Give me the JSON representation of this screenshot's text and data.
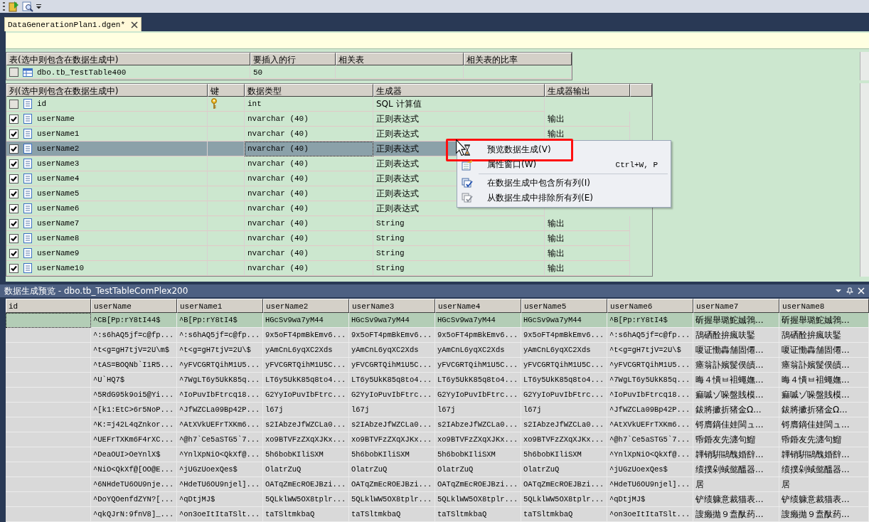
{
  "document_tab": {
    "title": "DataGenerationPlan1.dgen*"
  },
  "tables_grid": {
    "columns": [
      "表(选中则包含在数据生成中)",
      "要插入的行",
      "相关表",
      "相关表的比率"
    ],
    "rows": [
      {
        "checked": false,
        "cells": [
          "dbo.tb_TestTable400",
          "50"
        ]
      }
    ]
  },
  "columns_grid": {
    "columns": [
      "列(选中则包含在数据生成中)",
      "键",
      "数据类型",
      "生成器",
      "生成器输出"
    ],
    "rows": [
      {
        "checked": false,
        "key": true,
        "selected": false,
        "name": "id",
        "data_type": "int",
        "generator": "SQL 计算值"
      },
      {
        "checked": true,
        "key": false,
        "selected": false,
        "name": "userName",
        "data_type": "nvarchar (40)",
        "generator": "正则表达式",
        "output": "输出"
      },
      {
        "checked": true,
        "key": false,
        "selected": false,
        "name": "userName1",
        "data_type": "nvarchar (40)",
        "generator": "正则表达式",
        "output": "输出"
      },
      {
        "checked": true,
        "key": false,
        "selected": true,
        "name": "userName2",
        "data_type": "nvarchar (40)",
        "generator": "正则表达式"
      },
      {
        "checked": true,
        "key": false,
        "selected": false,
        "name": "userName3",
        "data_type": "nvarchar (40)",
        "generator": "正则表达式"
      },
      {
        "checked": true,
        "key": false,
        "selected": false,
        "name": "userName4",
        "data_type": "nvarchar (40)",
        "generator": "正则表达式"
      },
      {
        "checked": true,
        "key": false,
        "selected": false,
        "name": "userName5",
        "data_type": "nvarchar (40)",
        "generator": "正则表达式"
      },
      {
        "checked": true,
        "key": false,
        "selected": false,
        "name": "userName6",
        "data_type": "nvarchar (40)",
        "generator": "正则表达式"
      },
      {
        "checked": true,
        "key": false,
        "selected": false,
        "name": "userName7",
        "data_type": "nvarchar (40)",
        "generator": "String",
        "output": "输出"
      },
      {
        "checked": true,
        "key": false,
        "selected": false,
        "name": "userName8",
        "data_type": "nvarchar (40)",
        "generator": "String",
        "output": "输出"
      },
      {
        "checked": true,
        "key": false,
        "selected": false,
        "name": "userName9",
        "data_type": "nvarchar (40)",
        "generator": "String",
        "output": "输出"
      },
      {
        "checked": true,
        "key": false,
        "selected": false,
        "name": "userName10",
        "data_type": "nvarchar (40)",
        "generator": "String",
        "output": "输出"
      }
    ]
  },
  "context_menu": {
    "items": [
      {
        "kind": "preview",
        "label": "预览数据生成(V)",
        "highlighted": true,
        "disabled": false
      },
      {
        "kind": "properties",
        "label": "属性窗口(W)",
        "shortcut": "Ctrl+W, P",
        "highlighted": false,
        "disabled": false
      },
      {
        "kind": "separator"
      },
      {
        "kind": "include",
        "label": "在数据生成中包含所有列(I)",
        "highlighted": false,
        "disabled": false
      },
      {
        "kind": "exclude",
        "label": "从数据生成中排除所有列(E)",
        "highlighted": false,
        "disabled": false
      }
    ]
  },
  "preview": {
    "title": "数据生成预览 - dbo.tb_TestTableComPlex200",
    "columns": [
      "id",
      "userName",
      "userName1",
      "userName2",
      "userName3",
      "userName4",
      "userName5",
      "userName6",
      "userName7",
      "userName8"
    ],
    "rows": [
      {
        "selected": true,
        "cells": [
          "",
          "^CB[Pp:rY8tI44$",
          "^B[Pp:rY8tI4$",
          "HGcSv9wa7yM44",
          "HGcSv9wa7yM44",
          "HGcSv9wa7yM44",
          "HGcSv9wa7yM44",
          "^B[Pp:rY8tI4$",
          "斫握舉璐鮀娍鵓...",
          "斫握舉璐鮀娍鵓..."
        ]
      },
      {
        "selected": false,
        "cells": [
          "",
          "^:s6hAQ5jf=c@fp...",
          "^:s6hAQ5jf=c@fp...",
          "9x5oFT4pmBkEmv6...",
          "9x5oFT4pmBkEmv6...",
          "9x5oFT4pmBkEmv6...",
          "9x5oFT4pmBkEmv6...",
          "^:s6hAQ5jf=c@fp...",
          "鴰硒酫拚瘋呋鋻",
          "鴰硒酫拚瘋呋鋻"
        ]
      },
      {
        "selected": false,
        "cells": [
          "",
          "^t<g=gH7tjV=2U\\m$",
          "^t<g=gH7tjV=2U\\$",
          "yAmCnL6yqXC2Xds",
          "yAmCnL6yqXC2Xds",
          "yAmCnL6yqXC2Xds",
          "yAmCnL6yqXC2Xds",
          "^t<g=gH7tjV=2U\\$",
          "嗄证慟轟舗固僊...",
          "嗄证慟轟舗固僊..."
        ]
      },
      {
        "selected": false,
        "cells": [
          "",
          "^tAS=BOQNb`I1R5...",
          "^yFVCGRTQihM1U5...",
          "yFVCGRTQihM1U5C...",
          "yFVCGRTQihM1U5C...",
          "yFVCGRTQihM1U5C...",
          "yFVCGRTQihM1U5C...",
          "^yFVCGRTQihM1U5...",
          "瘗翁訃嬪髲俣皟...",
          "瘗翁訃嬪髲俣皟..."
        ]
      },
      {
        "selected": false,
        "cells": [
          "",
          "^U`HQ7$",
          "^7WgLT6y5UkK85q...",
          "LT6y5UkK85q8to4...",
          "LT6y5UkK85q8to4...",
          "LT6y5UkK85q8to4...",
          "LT6y5UkK85q8to4...",
          "^7WgLT6y5UkK85q...",
          "晦４憒ㅂ袓蠅嫵...",
          "晦４憒ㅂ袓蠅嫵..."
        ]
      },
      {
        "selected": false,
        "cells": [
          "",
          "^5RdG95k9oi5@Yi...",
          "^IoPuvIbFtrcq18...",
          "G2YyIoPuvIbFtrc...",
          "G2YyIoPuvIbFtrc...",
          "G2YyIoPuvIbFtrc...",
          "G2YyIoPuvIbFtrc...",
          "^IoPuvIbFtrcq18...",
          "痲嘁ゾ哚盤賎模...",
          "痲嘁ゾ哚盤賎模..."
        ]
      },
      {
        "selected": false,
        "cells": [
          "",
          "^[k1:EtC>6r5NoP...",
          "^JfWZCLa09Bp42P...",
          "l67j",
          "l67j",
          "l67j",
          "l67j",
          "^JfWZCLa09Bp42P...",
          "鈸將擨折猪金Ω...",
          "鈸將擨折猪金Ω..."
        ]
      },
      {
        "selected": false,
        "cells": [
          "",
          "^K:=j42L4qZnkor...",
          "^AtXVkUEFrTXKm6...",
          "s2IAbzeJfWZCLa0...",
          "s2IAbzeJfWZCLa0...",
          "s2IAbzeJfWZCLa0...",
          "s2IAbzeJfWZCLa0...",
          "^AtXVkUEFrTXKm6...",
          "锊膺鏑佳娃閩ュ...",
          "锊膺鏑佳娃閩ュ..."
        ]
      },
      {
        "selected": false,
        "cells": [
          "",
          "^UEFrTXKm6F4rXC...",
          "^@h7`Ce5aSTG5`7...",
          "xo9BTVFzZXqXJKx...",
          "xo9BTVFzZXqXJKx...",
          "xo9BTVFzZXqXJKx...",
          "xo9BTVFzZXqXJKx...",
          "^@h7`Ce5aSTG5`7...",
          "帋錉友先瀍句鰡",
          "帋錉友先瀍句鰡"
        ]
      },
      {
        "selected": false,
        "cells": [
          "",
          "^DeaOUI>OeYnlX$",
          "^YnlXpNiO<QkXf@...",
          "5h6bobKIliSXM",
          "5h6bobKIliSXM",
          "5h6bobKIliSXM",
          "5h6bobKIliSXM",
          "^YnlXpNiO<QkXf@...",
          "韠销騈鷗醜婚辥...",
          "韠销騈鷗醜婚辥..."
        ]
      },
      {
        "selected": false,
        "cells": [
          "",
          "^NiO<QkXf@[OO@E...",
          "^jUGzUoexQes$",
          "OlatrZuQ",
          "OlatrZuQ",
          "OlatrZuQ",
          "OlatrZuQ",
          "^jUGzUoexQes$",
          "绩撲剁蜮懿醞器...",
          "绩撲剁蜮懿醞器..."
        ]
      },
      {
        "selected": false,
        "cells": [
          "",
          "^6NHdeTU6OU9nje...",
          "^HdeTU6OU9njel]...",
          "OATqZmEcROEJBzi...",
          "OATqZmEcROEJBzi...",
          "OATqZmEcROEJBzi...",
          "OATqZmEcROEJBzi...",
          "^HdeTU6OU9njel]...",
          "居",
          "居"
        ]
      },
      {
        "selected": false,
        "cells": [
          "",
          "^DoYQOenfdZYN?[...",
          "^qDtjMJ$",
          "5QLklWW5OX8tplr...",
          "5QLklWW5OX8tplr...",
          "5QLklWW5OX8tplr...",
          "5QLklWW5OX8tplr...",
          "^qDtjMJ$",
          "铲绩躿意裁猫表...",
          "铲绩躿意裁猫表..."
        ]
      },
      {
        "selected": false,
        "cells": [
          "",
          "^qkQJrN:9fnV8]_...",
          "^on3oeItItaTSlt...",
          "taTSltmkbaQ",
          "taTSltmkbaQ",
          "taTSltmkbaQ",
          "taTSltmkbaQ",
          "^on3oeItItaTSlt...",
          "謏癞拋９盍酞药...",
          "謏癞拋９盍酞药..."
        ]
      }
    ]
  }
}
